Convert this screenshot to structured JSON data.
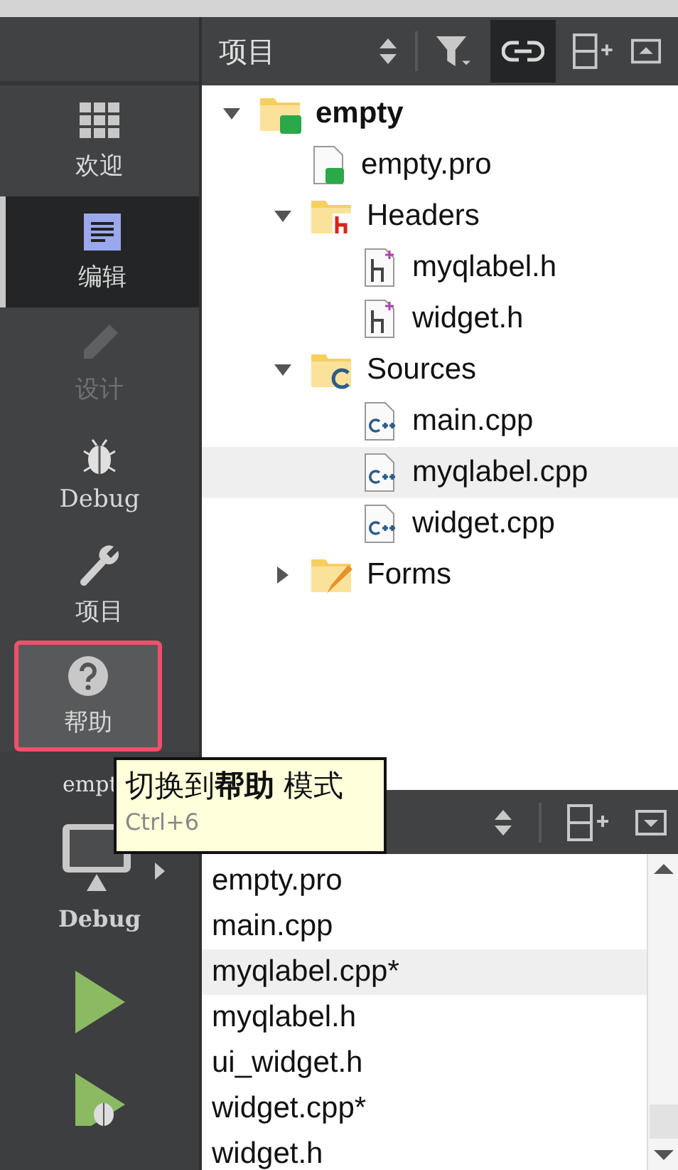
{
  "modes": [
    {
      "label": "欢迎",
      "kind": "welcome",
      "selected": false,
      "disabled": false,
      "highlighted": false
    },
    {
      "label": "编辑",
      "kind": "edit",
      "selected": true,
      "disabled": false,
      "highlighted": false
    },
    {
      "label": "设计",
      "kind": "design",
      "selected": false,
      "disabled": true,
      "highlighted": false
    },
    {
      "label": "Debug",
      "kind": "debug",
      "selected": false,
      "disabled": false,
      "highlighted": false
    },
    {
      "label": "项目",
      "kind": "project",
      "selected": false,
      "disabled": false,
      "highlighted": false
    },
    {
      "label": "帮助",
      "kind": "help",
      "selected": false,
      "disabled": false,
      "highlighted": true
    }
  ],
  "target": {
    "project": "empt",
    "config": "Debug"
  },
  "project_pane": {
    "view": "项目",
    "sync_on": true,
    "tree": [
      {
        "label": "empty",
        "kind": "project",
        "expanded": true,
        "selected": false,
        "children": [
          {
            "label": "empty.pro",
            "kind": "pro",
            "selected": false
          },
          {
            "label": "Headers",
            "kind": "headers",
            "expanded": true,
            "selected": false,
            "children": [
              {
                "label": "myqlabel.h",
                "kind": "h",
                "selected": false
              },
              {
                "label": "widget.h",
                "kind": "h",
                "selected": false
              }
            ]
          },
          {
            "label": "Sources",
            "kind": "sources",
            "expanded": true,
            "selected": false,
            "children": [
              {
                "label": "main.cpp",
                "kind": "cpp",
                "selected": false
              },
              {
                "label": "myqlabel.cpp",
                "kind": "cpp",
                "selected": true
              },
              {
                "label": "widget.cpp",
                "kind": "cpp",
                "selected": false
              }
            ]
          },
          {
            "label": "Forms",
            "kind": "forms",
            "expanded": false,
            "selected": false
          }
        ]
      }
    ]
  },
  "open_documents": [
    {
      "label": "empty.pro",
      "selected": false
    },
    {
      "label": "main.cpp",
      "selected": false
    },
    {
      "label": "myqlabel.cpp*",
      "selected": true
    },
    {
      "label": "myqlabel.h",
      "selected": false
    },
    {
      "label": "ui_widget.h",
      "selected": false
    },
    {
      "label": "widget.cpp*",
      "selected": false
    },
    {
      "label": "widget.h",
      "selected": false
    }
  ],
  "tooltip": {
    "text": "切换到**帮助** 模式",
    "shortcut": "Ctrl+6"
  }
}
